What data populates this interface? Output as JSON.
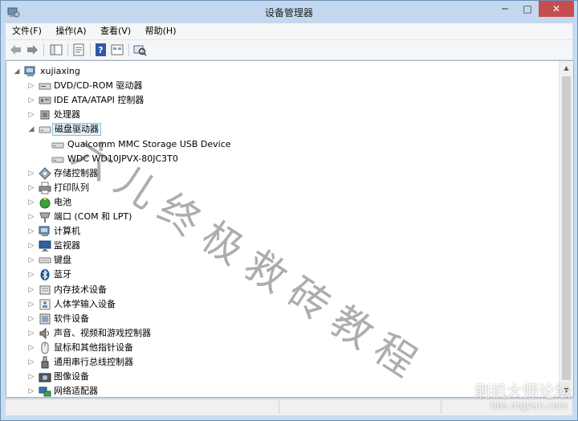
{
  "window": {
    "title": "设备管理器",
    "min_glyph": "─",
    "max_glyph": "□",
    "close_glyph": "✕"
  },
  "menu": [
    {
      "label": "文件(F)"
    },
    {
      "label": "操作(A)"
    },
    {
      "label": "查看(V)"
    },
    {
      "label": "帮助(H)"
    }
  ],
  "toolbar": {
    "buttons": [
      "back-icon",
      "forward-icon",
      "properties-icon",
      "console-tree-icon",
      "help-icon",
      "view-icon",
      "scan-hardware-icon"
    ]
  },
  "tree": {
    "expanded_glyph": "◢",
    "collapsed_glyph": "▷",
    "root": {
      "label": "xujiaxing",
      "icon": "computer-icon"
    },
    "items": [
      {
        "label": "DVD/CD-ROM 驱动器",
        "icon": "dvd-drive-icon"
      },
      {
        "label": "IDE ATA/ATAPI 控制器",
        "icon": "ide-controller-icon"
      },
      {
        "label": "处理器",
        "icon": "processor-icon"
      },
      {
        "label": "磁盘驱动器",
        "icon": "disk-drive-icon",
        "expanded": true,
        "selected": true,
        "children": [
          {
            "label": "Qualcomm MMC Storage USB Device",
            "icon": "disk-icon"
          },
          {
            "label": "WDC WD10JPVX-80JC3T0",
            "icon": "disk-icon"
          }
        ]
      },
      {
        "label": "存储控制器",
        "icon": "storage-controller-icon"
      },
      {
        "label": "打印队列",
        "icon": "printer-icon"
      },
      {
        "label": "电池",
        "icon": "battery-icon"
      },
      {
        "label": "端口 (COM 和 LPT)",
        "icon": "port-icon"
      },
      {
        "label": "计算机",
        "icon": "computer-icon"
      },
      {
        "label": "监视器",
        "icon": "monitor-icon"
      },
      {
        "label": "键盘",
        "icon": "keyboard-icon"
      },
      {
        "label": "蓝牙",
        "icon": "bluetooth-icon"
      },
      {
        "label": "内存技术设备",
        "icon": "memory-icon"
      },
      {
        "label": "人体学输入设备",
        "icon": "hid-icon"
      },
      {
        "label": "软件设备",
        "icon": "software-device-icon"
      },
      {
        "label": "声音、视频和游戏控制器",
        "icon": "sound-icon"
      },
      {
        "label": "鼠标和其他指针设备",
        "icon": "mouse-icon"
      },
      {
        "label": "通用串行总线控制器",
        "icon": "usb-icon"
      },
      {
        "label": "图像设备",
        "icon": "camera-icon"
      },
      {
        "label": "网络适配器",
        "icon": "network-icon"
      }
    ]
  },
  "scrollbar": {
    "up_glyph": "▲",
    "down_glyph": "▼"
  },
  "watermark": {
    "text": "六儿终极救砖教程"
  },
  "forum": {
    "logo": "刷机大师论坛",
    "url": "bbs.mgyun.com"
  },
  "colors": {
    "selection_bg": "#e5f3fb",
    "selection_border": "#7dc4e7",
    "close_button": "#c74e4e"
  }
}
